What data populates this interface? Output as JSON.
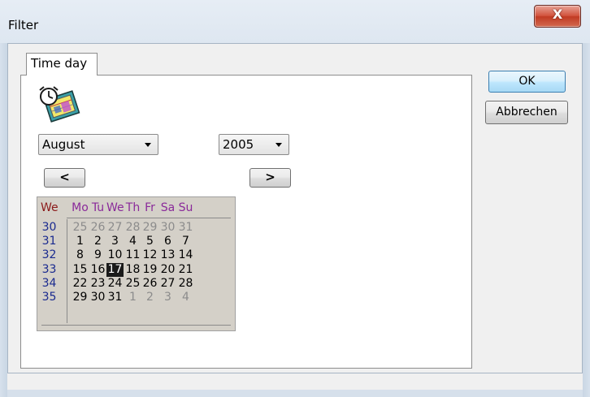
{
  "window": {
    "title": "Filter",
    "close_glyph": "X"
  },
  "tabs": [
    {
      "label": "Time day",
      "active": true
    }
  ],
  "buttons": {
    "ok": "OK",
    "cancel": "Abbrechen"
  },
  "icons": {
    "calendar": "calendar-clock-icon",
    "close": "close-icon"
  },
  "month_select": {
    "value": "August"
  },
  "year_select": {
    "value": "2005"
  },
  "nav": {
    "prev": "<",
    "next": ">"
  },
  "calendar": {
    "week_header": "We",
    "day_headers": [
      "Mo",
      "Tu",
      "We",
      "Th",
      "Fr",
      "Sa",
      "Su"
    ],
    "selected_day": "17",
    "weeks": [
      {
        "week": "30",
        "days": [
          {
            "d": "25",
            "m": "prev"
          },
          {
            "d": "26",
            "m": "prev"
          },
          {
            "d": "27",
            "m": "prev"
          },
          {
            "d": "28",
            "m": "prev"
          },
          {
            "d": "29",
            "m": "prev"
          },
          {
            "d": "30",
            "m": "prev"
          },
          {
            "d": "31",
            "m": "prev"
          }
        ]
      },
      {
        "week": "31",
        "days": [
          {
            "d": "1",
            "m": "cur"
          },
          {
            "d": "2",
            "m": "cur"
          },
          {
            "d": "3",
            "m": "cur"
          },
          {
            "d": "4",
            "m": "cur"
          },
          {
            "d": "5",
            "m": "cur"
          },
          {
            "d": "6",
            "m": "cur"
          },
          {
            "d": "7",
            "m": "cur"
          }
        ]
      },
      {
        "week": "32",
        "days": [
          {
            "d": "8",
            "m": "cur"
          },
          {
            "d": "9",
            "m": "cur"
          },
          {
            "d": "10",
            "m": "cur"
          },
          {
            "d": "11",
            "m": "cur"
          },
          {
            "d": "12",
            "m": "cur"
          },
          {
            "d": "13",
            "m": "cur"
          },
          {
            "d": "14",
            "m": "cur"
          }
        ]
      },
      {
        "week": "33",
        "days": [
          {
            "d": "15",
            "m": "cur"
          },
          {
            "d": "16",
            "m": "cur"
          },
          {
            "d": "17",
            "m": "cur"
          },
          {
            "d": "18",
            "m": "cur"
          },
          {
            "d": "19",
            "m": "cur"
          },
          {
            "d": "20",
            "m": "cur"
          },
          {
            "d": "21",
            "m": "cur"
          }
        ]
      },
      {
        "week": "34",
        "days": [
          {
            "d": "22",
            "m": "cur"
          },
          {
            "d": "23",
            "m": "cur"
          },
          {
            "d": "24",
            "m": "cur"
          },
          {
            "d": "25",
            "m": "cur"
          },
          {
            "d": "26",
            "m": "cur"
          },
          {
            "d": "27",
            "m": "cur"
          },
          {
            "d": "28",
            "m": "cur"
          }
        ]
      },
      {
        "week": "35",
        "days": [
          {
            "d": "29",
            "m": "cur"
          },
          {
            "d": "30",
            "m": "cur"
          },
          {
            "d": "31",
            "m": "cur"
          },
          {
            "d": "1",
            "m": "next"
          },
          {
            "d": "2",
            "m": "next"
          },
          {
            "d": "3",
            "m": "next"
          },
          {
            "d": "4",
            "m": "next"
          }
        ]
      }
    ]
  },
  "colors": {
    "week_header": "#8b1a1a",
    "day_header": "#8a2a9a",
    "week_number": "#1a2a8f",
    "other_month_day": "#8c8c8c",
    "selected_bg": "#1a1a1a",
    "calendar_bg": "#d4d0c8",
    "close_button": "#c13b23"
  }
}
